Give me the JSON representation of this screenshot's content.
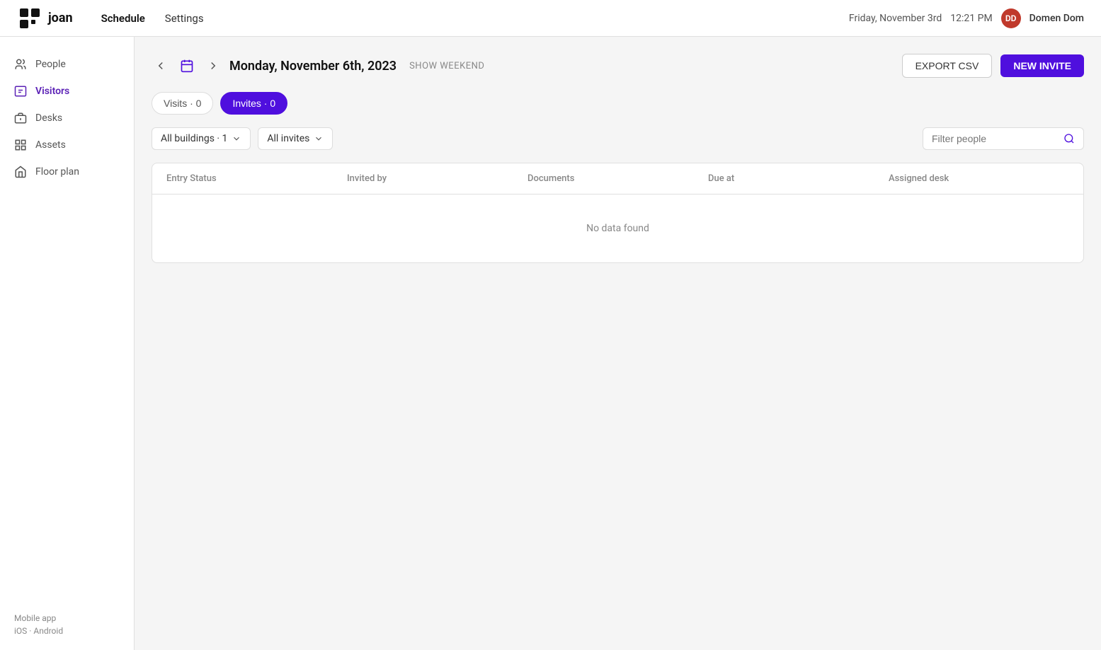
{
  "topnav": {
    "logo_text": "joan",
    "links": [
      {
        "label": "Schedule",
        "active": true
      },
      {
        "label": "Settings",
        "active": false
      }
    ],
    "date": "Friday, November 3rd",
    "time": "12:21 PM",
    "user_initials": "DD",
    "user_name": "Domen Dom"
  },
  "sidebar": {
    "items": [
      {
        "label": "People",
        "icon": "people-icon",
        "active": false
      },
      {
        "label": "Visitors",
        "icon": "visitors-icon",
        "active": true
      },
      {
        "label": "Desks",
        "icon": "desks-icon",
        "active": false
      },
      {
        "label": "Assets",
        "icon": "assets-icon",
        "active": false
      },
      {
        "label": "Floor plan",
        "icon": "floorplan-icon",
        "active": false
      }
    ],
    "mobile_app_label": "Mobile app",
    "mobile_links": "iOS · Android"
  },
  "main": {
    "current_date": "Monday, November 6th, 2023",
    "show_weekend": "SHOW WEEKEND",
    "export_label": "EXPORT CSV",
    "new_invite_label": "NEW INVITE",
    "tabs": [
      {
        "label": "Visits · 0",
        "active": false
      },
      {
        "label": "Invites · 0",
        "active": true
      }
    ],
    "filters": {
      "buildings": "All buildings · 1",
      "invites": "All invites",
      "search_placeholder": "Filter people"
    },
    "table": {
      "columns": [
        "Entry Status",
        "Invited by",
        "Documents",
        "Due at",
        "Assigned desk"
      ],
      "empty_message": "No data found"
    }
  }
}
